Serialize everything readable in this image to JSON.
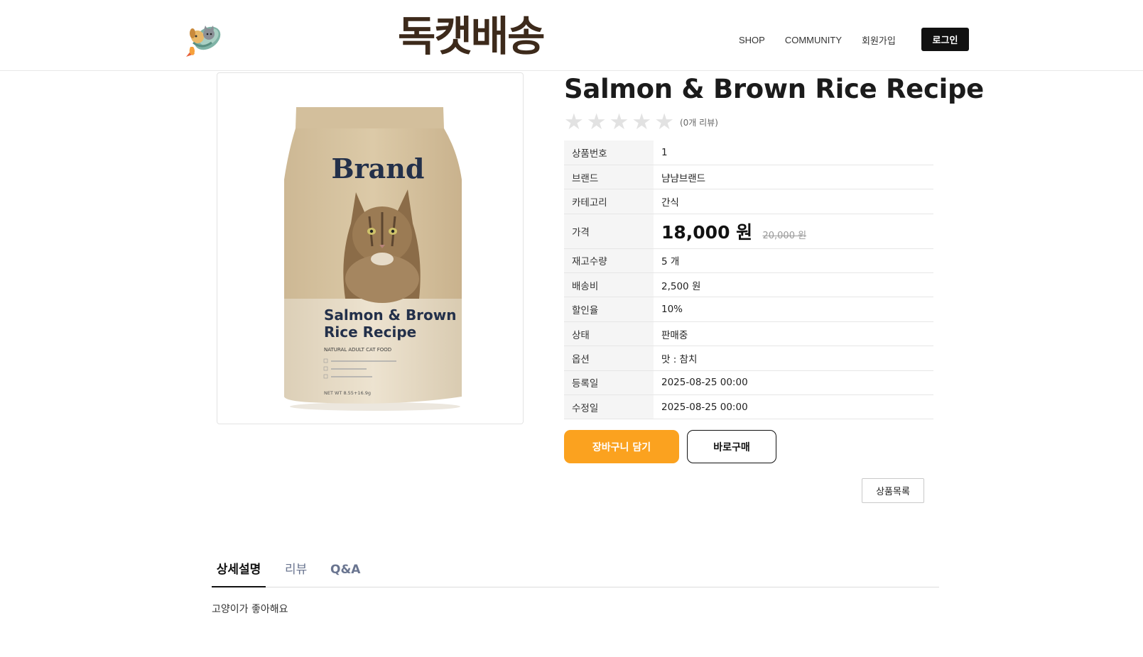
{
  "header": {
    "site_title": "독캣배송",
    "nav": [
      "SHOP",
      "COMMUNITY",
      "회원가입"
    ],
    "login_label": "로그인"
  },
  "product": {
    "image": {
      "brand": "Brand",
      "name_line1": "Salmon & Brown",
      "name_line2": "Rice Recipe",
      "subtitle": "NATURAL ADULT CAT FOOD",
      "weight": "NET WT 8.55+16.9g"
    },
    "title": "Salmon & Brown Rice Recipe",
    "rating": {
      "stars": 0,
      "max": 5,
      "review_count_text": "(0개 리뷰)"
    },
    "details": [
      {
        "label": "상품번호",
        "value": "1"
      },
      {
        "label": "브랜드",
        "value": "냠냠브랜드"
      },
      {
        "label": "카테고리",
        "value": "간식"
      },
      {
        "label": "가격",
        "price_now": "18,000 원",
        "price_old": "20,000 원"
      },
      {
        "label": "재고수량",
        "value": "5 개"
      },
      {
        "label": "배송비",
        "value": "2,500 원"
      },
      {
        "label": "할인율",
        "value": "10%"
      },
      {
        "label": "상태",
        "value": "판매중"
      },
      {
        "label": "옵션",
        "value": "맛 : 참치"
      },
      {
        "label": "등록일",
        "value": "2025-08-25 00:00"
      },
      {
        "label": "수정일",
        "value": "2025-08-25 00:00"
      }
    ],
    "buttons": {
      "cart": "장바구니 담기",
      "buy": "바로구매",
      "list": "상품목록"
    }
  },
  "tabs": [
    "상세설명",
    "리뷰",
    "Q&A"
  ],
  "active_tab": 0,
  "description": "고양이가 좋아해요",
  "colors": {
    "accent": "#fba21f",
    "title": "#3d2a1b"
  }
}
